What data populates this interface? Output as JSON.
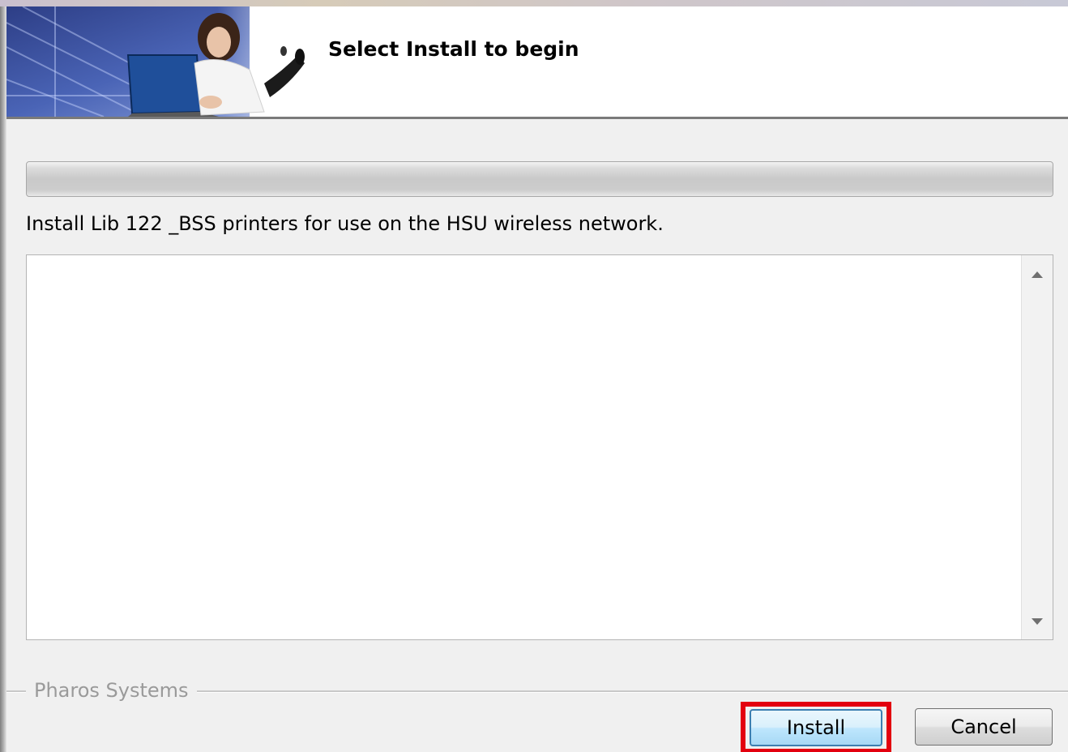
{
  "header": {
    "title": "Select Install to begin"
  },
  "progress": {
    "value_percent": 0
  },
  "description": "Install Lib 122 _BSS printers for use on the HSU wireless network.",
  "log": {
    "text": ""
  },
  "footer": {
    "group_label": "Pharos Systems"
  },
  "buttons": {
    "install_label": "Install",
    "cancel_label": "Cancel"
  },
  "icons": {
    "scroll_up": "scroll-up-arrow-icon",
    "scroll_down": "scroll-down-arrow-icon"
  },
  "colors": {
    "highlight": "#e3000f",
    "progress_track": "#cccccc"
  }
}
